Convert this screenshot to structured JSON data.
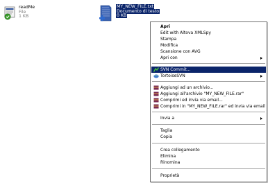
{
  "files": [
    {
      "name": "readMe",
      "type": "File",
      "size": "1 KB",
      "icon": "text-file-svn-ok-icon"
    },
    {
      "name": "MY_NEW_FILE.txt",
      "type": "Documento di testo",
      "size": "0 KB",
      "icon": "text-document-svn-add-icon"
    }
  ],
  "context_menu": {
    "open": "Apri",
    "edit_xmlspy": "Edit with Altova XMLSpy",
    "print": "Stampa",
    "edit": "Modifica",
    "scan_avg": "Scansione con AVG",
    "open_with": "Apri con",
    "svn_commit": "SVN Commit...",
    "tortoise": "TortoiseSVN",
    "add_archive": "Aggiungi ad un archivio...",
    "add_to_rar": "Aggiungi all'archivio \"MY_NEW_FILE.rar\"",
    "compress_email": "Comprimi ed invia via email...",
    "compress_rar_email": "Comprimi in \"MY_NEW_FILE.rar\" ed invia via email",
    "send_to": "Invia a",
    "cut": "Taglia",
    "copy": "Copia",
    "create_shortcut": "Crea collegamento",
    "delete": "Elimina",
    "rename": "Rinomina",
    "properties": "Proprietà"
  },
  "colors": {
    "selection": "#0a246a",
    "svn_ok": "#3a9a2a",
    "svn_add": "#2d6ad0",
    "rar": "#7a2a52"
  }
}
